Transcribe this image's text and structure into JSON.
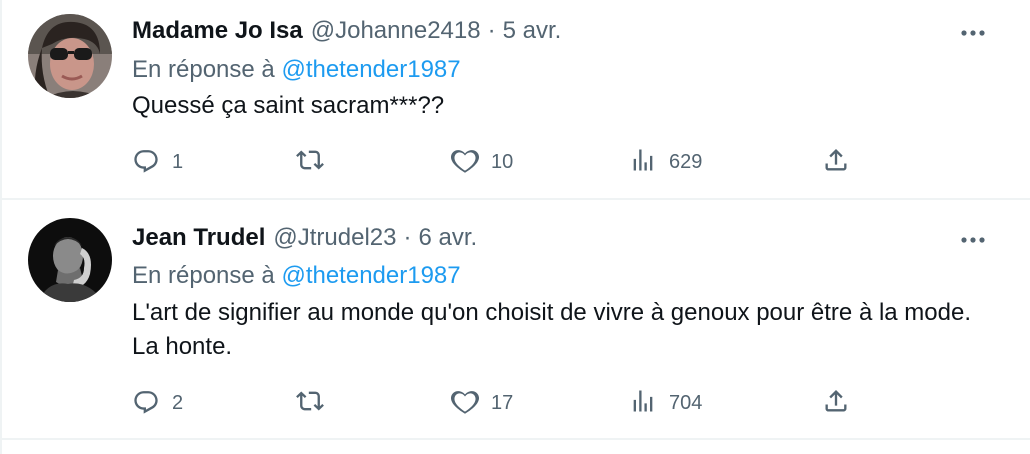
{
  "tweets": [
    {
      "display_name": "Madame Jo Isa",
      "handle": "@Johanne2418",
      "separator": "·",
      "date": "5 avr.",
      "reply_prefix": "En réponse à",
      "reply_mention": "@thetender1987",
      "text": "Quessé ça saint sacram***??",
      "replies": "1",
      "retweets": "",
      "likes": "10",
      "views": "629"
    },
    {
      "display_name": "Jean Trudel",
      "handle": "@Jtrudel23",
      "separator": "·",
      "date": "6 avr.",
      "reply_prefix": "En réponse à",
      "reply_mention": "@thetender1987",
      "text": "L'art de signifier au monde qu'on choisit de vivre à genoux pour être à la mode. La honte.",
      "replies": "2",
      "retweets": "",
      "likes": "17",
      "views": "704"
    }
  ],
  "colors": {
    "text_primary": "#0f1419",
    "text_secondary": "#536471",
    "link": "#1d9bf0",
    "divider": "#eff3f4"
  },
  "icons": {
    "reply": "reply-icon",
    "retweet": "retweet-icon",
    "like": "heart-icon",
    "views": "views-icon",
    "share": "share-icon",
    "more": "more-icon"
  }
}
